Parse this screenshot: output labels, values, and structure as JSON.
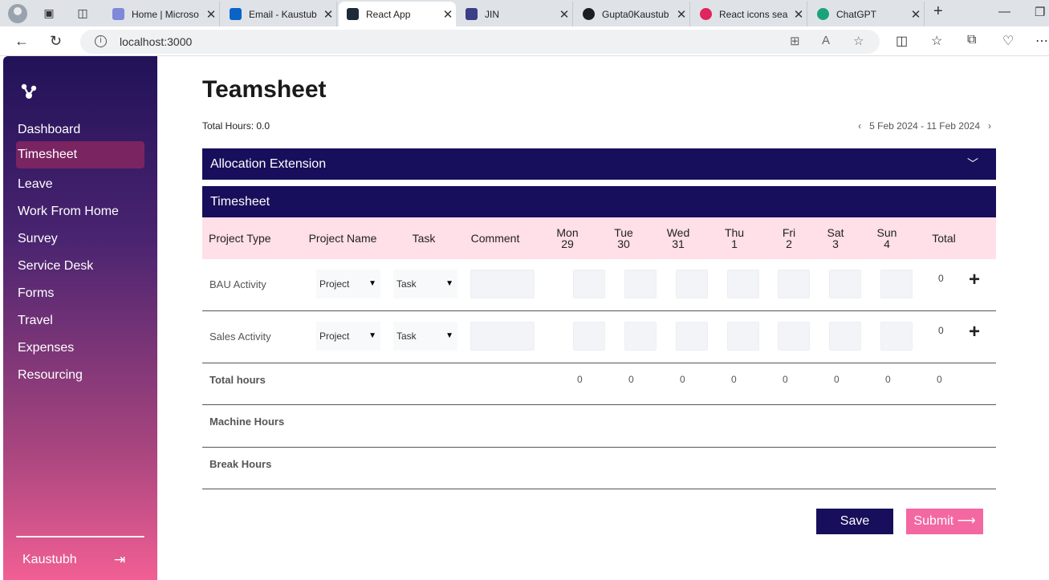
{
  "browser": {
    "tabs": [
      {
        "label": "Home | Microso",
        "color": "#7f88d9"
      },
      {
        "label": "Email - Kaustub",
        "color": "#0a64c8"
      },
      {
        "label": "React App",
        "color": "#1e2a38"
      },
      {
        "label": "JIN",
        "color": "#3b3f85"
      },
      {
        "label": "Gupta0Kaustub",
        "color": "#1b1f24"
      },
      {
        "label": "React icons sea",
        "color": "#e0245e"
      },
      {
        "label": "ChatGPT",
        "color": "#1aa37a"
      }
    ],
    "url": "localhost:3000"
  },
  "sidebar": {
    "items": [
      {
        "label": "Dashboard"
      },
      {
        "label": "Timesheet"
      },
      {
        "label": "Leave"
      },
      {
        "label": "Work From Home"
      },
      {
        "label": "Survey"
      },
      {
        "label": "Service Desk"
      },
      {
        "label": "Forms"
      },
      {
        "label": "Travel"
      },
      {
        "label": "Expenses"
      },
      {
        "label": "Resourcing"
      }
    ],
    "active_item": "Timesheet",
    "user": "Kaustubh"
  },
  "main": {
    "title": "Teamsheet",
    "total_hours_label": "Total Hours: 0.0",
    "date_range": "5 Feb 2024 - 11 Feb 2024",
    "allocation_header": "Allocation Extension",
    "timesheet_header": "Timesheet",
    "columns": {
      "project_type": "Project Type",
      "project_name": "Project Name",
      "task": "Task",
      "comment": "Comment",
      "total": "Total"
    },
    "days": [
      {
        "day": "Mon",
        "date": "29"
      },
      {
        "day": "Tue",
        "date": "30"
      },
      {
        "day": "Wed",
        "date": "31"
      },
      {
        "day": "Thu",
        "date": "1"
      },
      {
        "day": "Fri",
        "date": "2"
      },
      {
        "day": "Sat",
        "date": "3"
      },
      {
        "day": "Sun",
        "date": "4"
      }
    ],
    "rows": [
      {
        "label": "BAU Activity",
        "project": "Project",
        "task": "Task",
        "total": "0"
      },
      {
        "label": "Sales Activity",
        "project": "Project",
        "task": "Task",
        "total": "0"
      }
    ],
    "total_hours_row": {
      "label": "Total hours",
      "values": [
        "0",
        "0",
        "0",
        "0",
        "0",
        "0",
        "0",
        "0"
      ]
    },
    "machine_hours_label": "Machine Hours",
    "break_hours_label": "Break Hours",
    "save_label": "Save",
    "submit_label": "Submit"
  },
  "colors": {
    "header": "#170f5b",
    "table_head": "#ffdfe8",
    "submit": "#f368a1"
  }
}
